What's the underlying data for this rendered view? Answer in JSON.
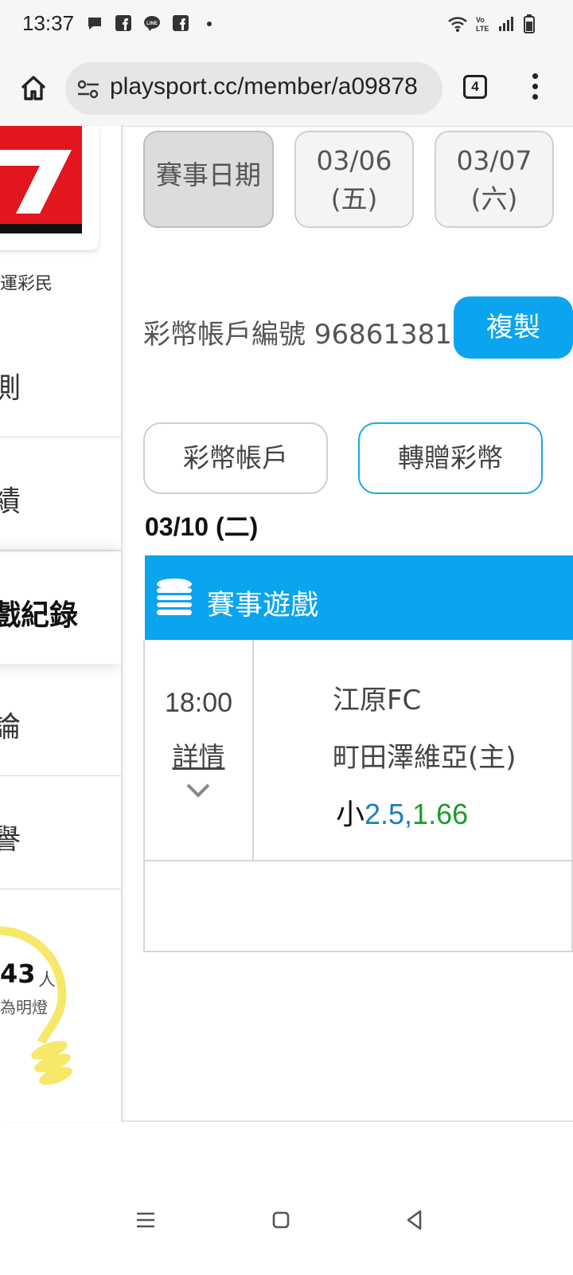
{
  "status_bar": {
    "time": "13:37",
    "notification_icons": [
      "chat-bubble-icon",
      "facebook-icon",
      "line-icon",
      "facebook-icon",
      "dot-icon"
    ],
    "system_icons": [
      "wifi-icon",
      "volte-icon",
      "signal-icon",
      "battery-icon"
    ]
  },
  "browser": {
    "url": "playsport.cc/member/a09878",
    "tab_count": "4"
  },
  "sidebar": {
    "user_label": "運彩民",
    "items": [
      {
        "label": "測"
      },
      {
        "label": "績"
      },
      {
        "label": "戲紀錄",
        "active": true
      },
      {
        "label": "論"
      },
      {
        "label": "譽"
      }
    ],
    "bulb": {
      "count": "43",
      "unit": "人",
      "caption": "為明燈"
    }
  },
  "date_tabs": [
    {
      "line1": "賽事日期",
      "line2": "",
      "active": true
    },
    {
      "line1": "03/06",
      "line2": "(五)",
      "active": false
    },
    {
      "line1": "03/07",
      "line2": "(六)",
      "active": false
    }
  ],
  "account": {
    "label": "彩幣帳戶編號 96861381",
    "copy_label": "複製"
  },
  "actions": {
    "account_button": "彩幣帳戶",
    "transfer_button": "轉贈彩幣"
  },
  "game_date": "03/10 (二)",
  "game_section": {
    "title": "賽事遊戲",
    "matches": [
      {
        "time": "18:00",
        "details": "詳情",
        "away_team": "江原FC",
        "home_team": "町田澤維亞(主)",
        "pick_side": "小",
        "pick_line": "2.5,",
        "pick_price": "1.66"
      }
    ]
  },
  "colors": {
    "accent": "#0aa5ee",
    "line_blue": "#1a7fc4",
    "odds_green": "#1d9b2a",
    "bulb_yellow": "#f7e86a",
    "logo_red": "#e3151f"
  }
}
